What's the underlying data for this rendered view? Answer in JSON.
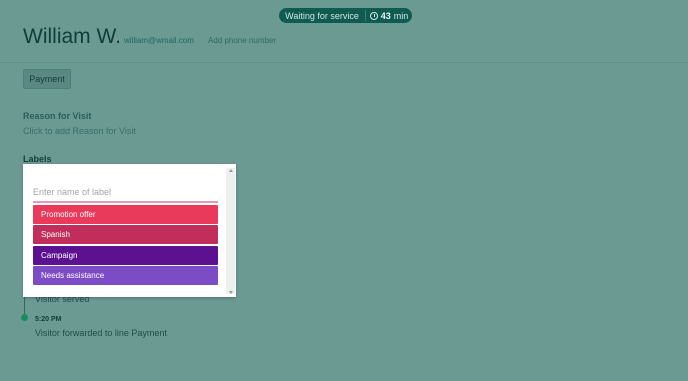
{
  "status": {
    "text": "Waiting for service",
    "time": "43",
    "unit": "min"
  },
  "visitor": {
    "name": "William W.",
    "email": "william@wmail.com",
    "phone_link": "Add phone number"
  },
  "payment_button": "Payment",
  "reason": {
    "heading": "Reason for Visit",
    "placeholder": "Click to add Reason for Visit"
  },
  "labels": {
    "heading": "Labels",
    "input_placeholder": "Enter name of label",
    "options": [
      {
        "label": "Promotion offer",
        "color": "#e93a5b"
      },
      {
        "label": "Spanish",
        "color": "#c22e5c"
      },
      {
        "label": "Campaign",
        "color": "#5b1190"
      },
      {
        "label": "Needs assistance",
        "color": "#7c4bc6"
      }
    ]
  },
  "timeline": [
    {
      "text": "Visitor served"
    },
    {
      "time": "5:20 PM",
      "text": "Visitor forwarded to line Payment"
    }
  ]
}
